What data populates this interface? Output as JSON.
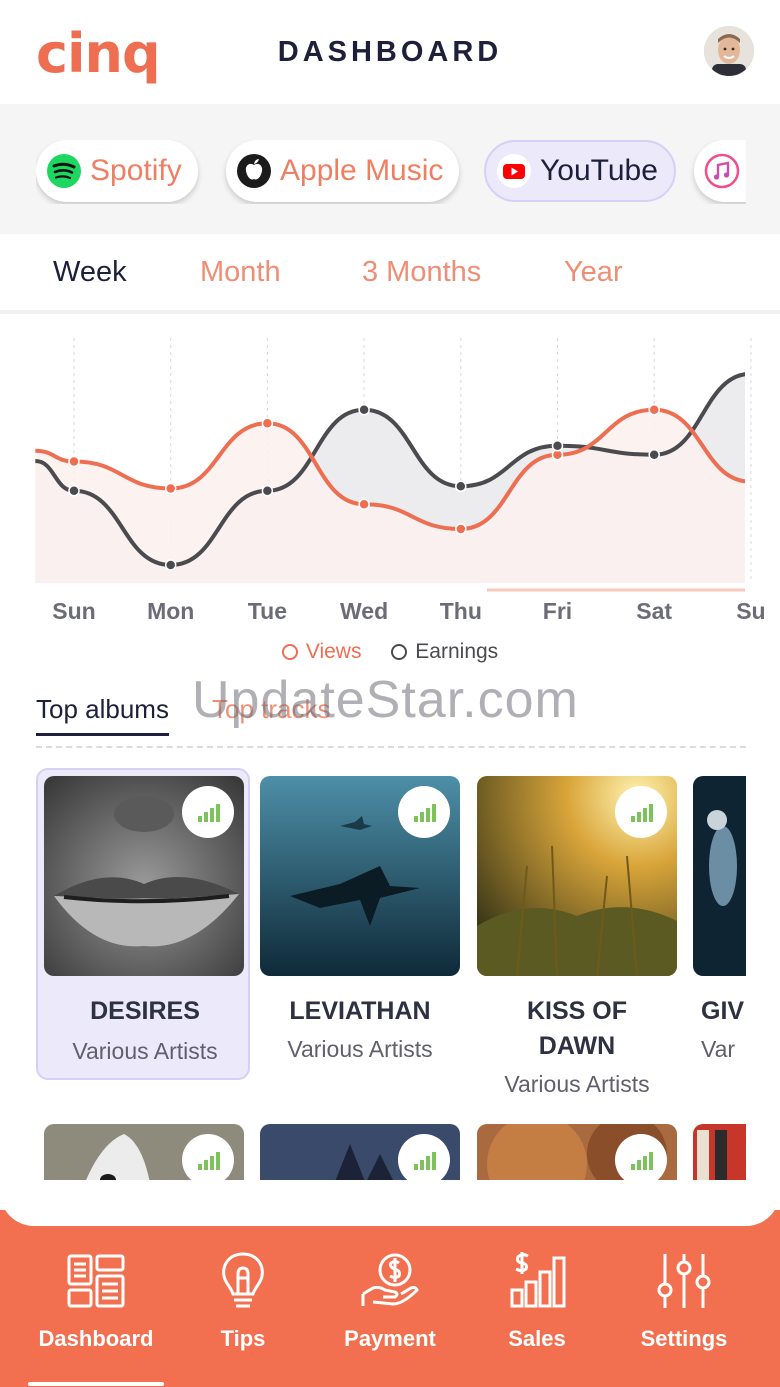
{
  "header": {
    "logo": "cinq",
    "title": "DASHBOARD"
  },
  "platforms": [
    {
      "label": "Spotify",
      "icon": "spotify-icon",
      "active": false
    },
    {
      "label": "Apple Music",
      "icon": "apple-icon",
      "active": false
    },
    {
      "label": "YouTube",
      "icon": "youtube-icon",
      "active": true
    },
    {
      "label": "",
      "icon": "itunes-icon",
      "active": false
    }
  ],
  "periods": {
    "items": [
      "Week",
      "Month",
      "3 Months",
      "Year"
    ],
    "selected": "Week"
  },
  "chart_data": {
    "type": "line",
    "categories": [
      "Sun",
      "Mon",
      "Tue",
      "Wed",
      "Thu",
      "Fri",
      "Sat",
      "Su"
    ],
    "series": [
      {
        "name": "Views",
        "color": "#ee6e52",
        "values": [
          54,
          42,
          71,
          35,
          24,
          57,
          77,
          45
        ]
      },
      {
        "name": "Earnings",
        "color": "#4b4b4f",
        "values": [
          41,
          8,
          41,
          77,
          43,
          61,
          57,
          93
        ]
      }
    ],
    "ylim": [
      0,
      100
    ],
    "smooth": true,
    "area": true,
    "grid": "vertical-dashed",
    "legend_position": "bottom"
  },
  "legend": {
    "views": "Views",
    "earnings": "Earnings"
  },
  "content_tabs": {
    "top_albums": "Top albums",
    "top_tracks": "Top tracks"
  },
  "watermark": "UpdateStar.com",
  "albums": [
    {
      "title": "DESIRES",
      "artist": "Various Artists",
      "selected": true
    },
    {
      "title": "LEVIATHAN",
      "artist": "Various Artists",
      "selected": false
    },
    {
      "title": "KISS OF DAWN",
      "artist": "Various Artists",
      "selected": false
    },
    {
      "title": "GIV",
      "artist": "Var",
      "selected": false
    }
  ],
  "colors": {
    "accent": "#ee6e52",
    "nav_background": "#f2704f",
    "selected_tint": "#ece9fb",
    "text_dark": "#1e1f3a",
    "signal_green": "#7cc35c"
  },
  "nav": [
    {
      "label": "Dashboard",
      "icon": "dashboard-icon",
      "active": true
    },
    {
      "label": "Tips",
      "icon": "lightbulb-icon",
      "active": false
    },
    {
      "label": "Payment",
      "icon": "payment-icon",
      "active": false
    },
    {
      "label": "Sales",
      "icon": "sales-chart-icon",
      "active": false
    },
    {
      "label": "Settings",
      "icon": "settings-sliders-icon",
      "active": false
    }
  ]
}
